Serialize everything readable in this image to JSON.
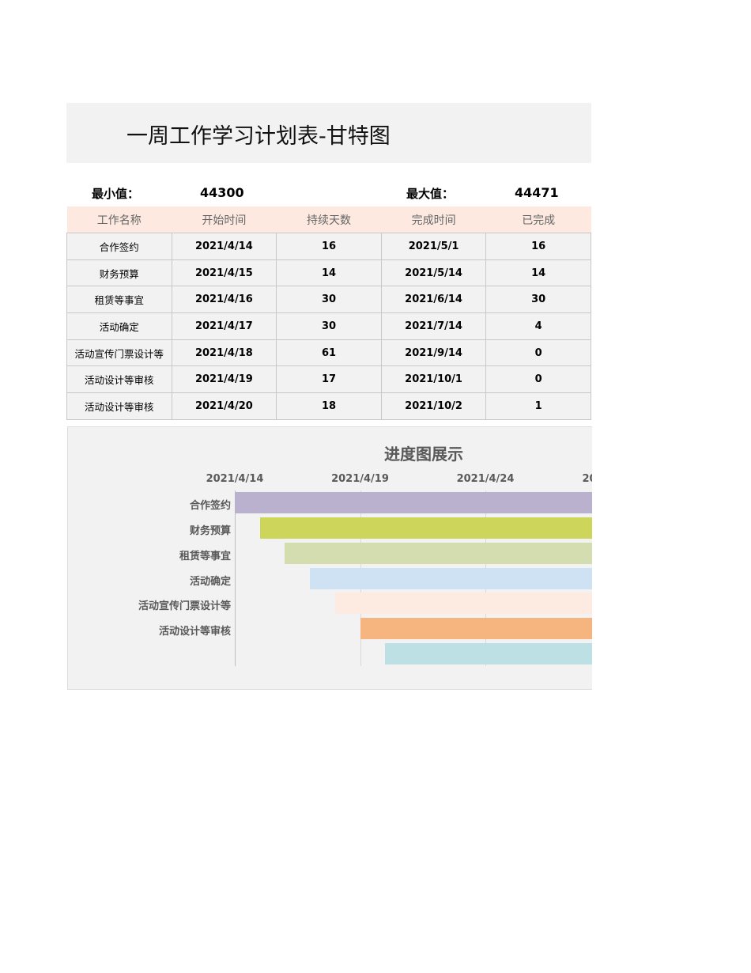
{
  "title": "一周工作学习计划表-甘特图",
  "min_label": "最小值：",
  "min_value": "44300",
  "max_label": "最大值：",
  "max_value": "44471",
  "headers": [
    "工作名称",
    "开始时间",
    "持续天数",
    "完成时间",
    "已完成"
  ],
  "rows": [
    [
      "合作签约",
      "2021/4/14",
      "16",
      "2021/5/1",
      "16"
    ],
    [
      "财务预算",
      "2021/4/15",
      "14",
      "2021/5/14",
      "14"
    ],
    [
      "租赁等事宜",
      "2021/4/16",
      "30",
      "2021/6/14",
      "30"
    ],
    [
      "活动确定",
      "2021/4/17",
      "30",
      "2021/7/14",
      "4"
    ],
    [
      "活动宣传门票设计等",
      "2021/4/18",
      "61",
      "2021/9/14",
      "0"
    ],
    [
      "活动设计等审核",
      "2021/4/19",
      "17",
      "2021/10/1",
      "0"
    ],
    [
      "活动设计等审核",
      "2021/4/20",
      "18",
      "2021/10/2",
      "1"
    ]
  ],
  "chart_data": {
    "type": "bar",
    "orientation": "horizontal-gantt",
    "title": "进度图展示",
    "x_ticks": [
      "2021/4/14",
      "2021/4/19",
      "2021/4/24",
      "20"
    ],
    "categories": [
      "合作签约",
      "财务预算",
      "租赁等事宜",
      "活动确定",
      "活动宣传门票设计等",
      "活动设计等审核",
      ""
    ],
    "start_offset_days": [
      0,
      1,
      2,
      3,
      4,
      5,
      6
    ],
    "duration_days": [
      16,
      14,
      30,
      30,
      61,
      17,
      18
    ],
    "colors": [
      "#b9b1cd",
      "#cdd55a",
      "#d3ddb0",
      "#cfe2f3",
      "#fdeae0",
      "#f6b47f",
      "#bde0e5"
    ]
  }
}
